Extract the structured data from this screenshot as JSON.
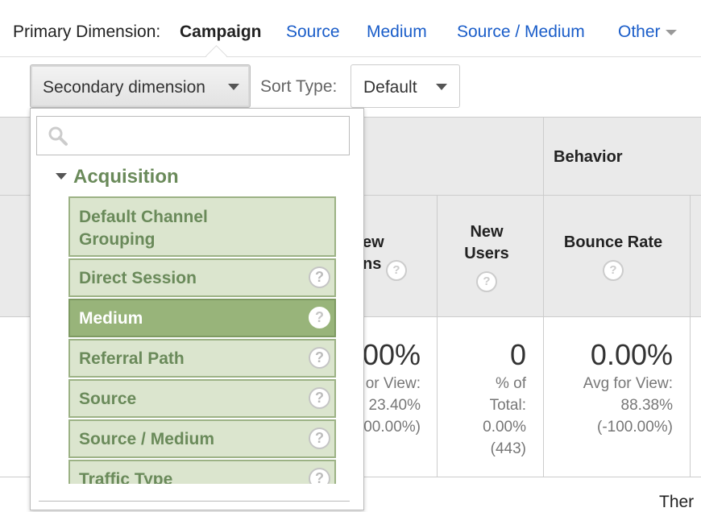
{
  "primary_dimension": {
    "label": "Primary Dimension:",
    "active": "Campaign",
    "links": [
      "Source",
      "Medium",
      "Source / Medium",
      "Other"
    ]
  },
  "toolbar": {
    "secondary_dimension_label": "Secondary dimension",
    "sort_type_label": "Sort Type:",
    "sort_type_value": "Default"
  },
  "dropdown": {
    "search_placeholder": "",
    "group_label": "Acquisition",
    "items": [
      {
        "label": "Default Channel Grouping",
        "help": false
      },
      {
        "label": "Direct Session",
        "help": true
      },
      {
        "label": "Medium",
        "help": true,
        "selected": true
      },
      {
        "label": "Referral Path",
        "help": true
      },
      {
        "label": "Source",
        "help": true
      },
      {
        "label": "Source / Medium",
        "help": true
      },
      {
        "label": "Traffic Type",
        "help": true
      }
    ],
    "help_glyph": "?"
  },
  "table": {
    "group_header": "Behavior",
    "columns": [
      {
        "label_lines": [
          "ew",
          "ns"
        ],
        "value": "00%",
        "sub": [
          "or View:",
          "23.40%",
          "00.00%)"
        ]
      },
      {
        "label_lines": [
          "New",
          "Users"
        ],
        "value": "0",
        "sub": [
          "% of",
          "Total:",
          "0.00%",
          "(443)"
        ]
      },
      {
        "label_lines": [
          "Bounce Rate"
        ],
        "value": "0.00%",
        "sub": [
          "Avg for View:",
          "88.38%",
          "(-100.00%)"
        ]
      }
    ],
    "help_glyph": "?",
    "footer_partial": "Ther"
  },
  "colors": {
    "link": "#1a5dc9",
    "item_bg": "#dbe5ce",
    "item_selected_bg": "#98b47a",
    "group_text": "#6a8a5a"
  }
}
